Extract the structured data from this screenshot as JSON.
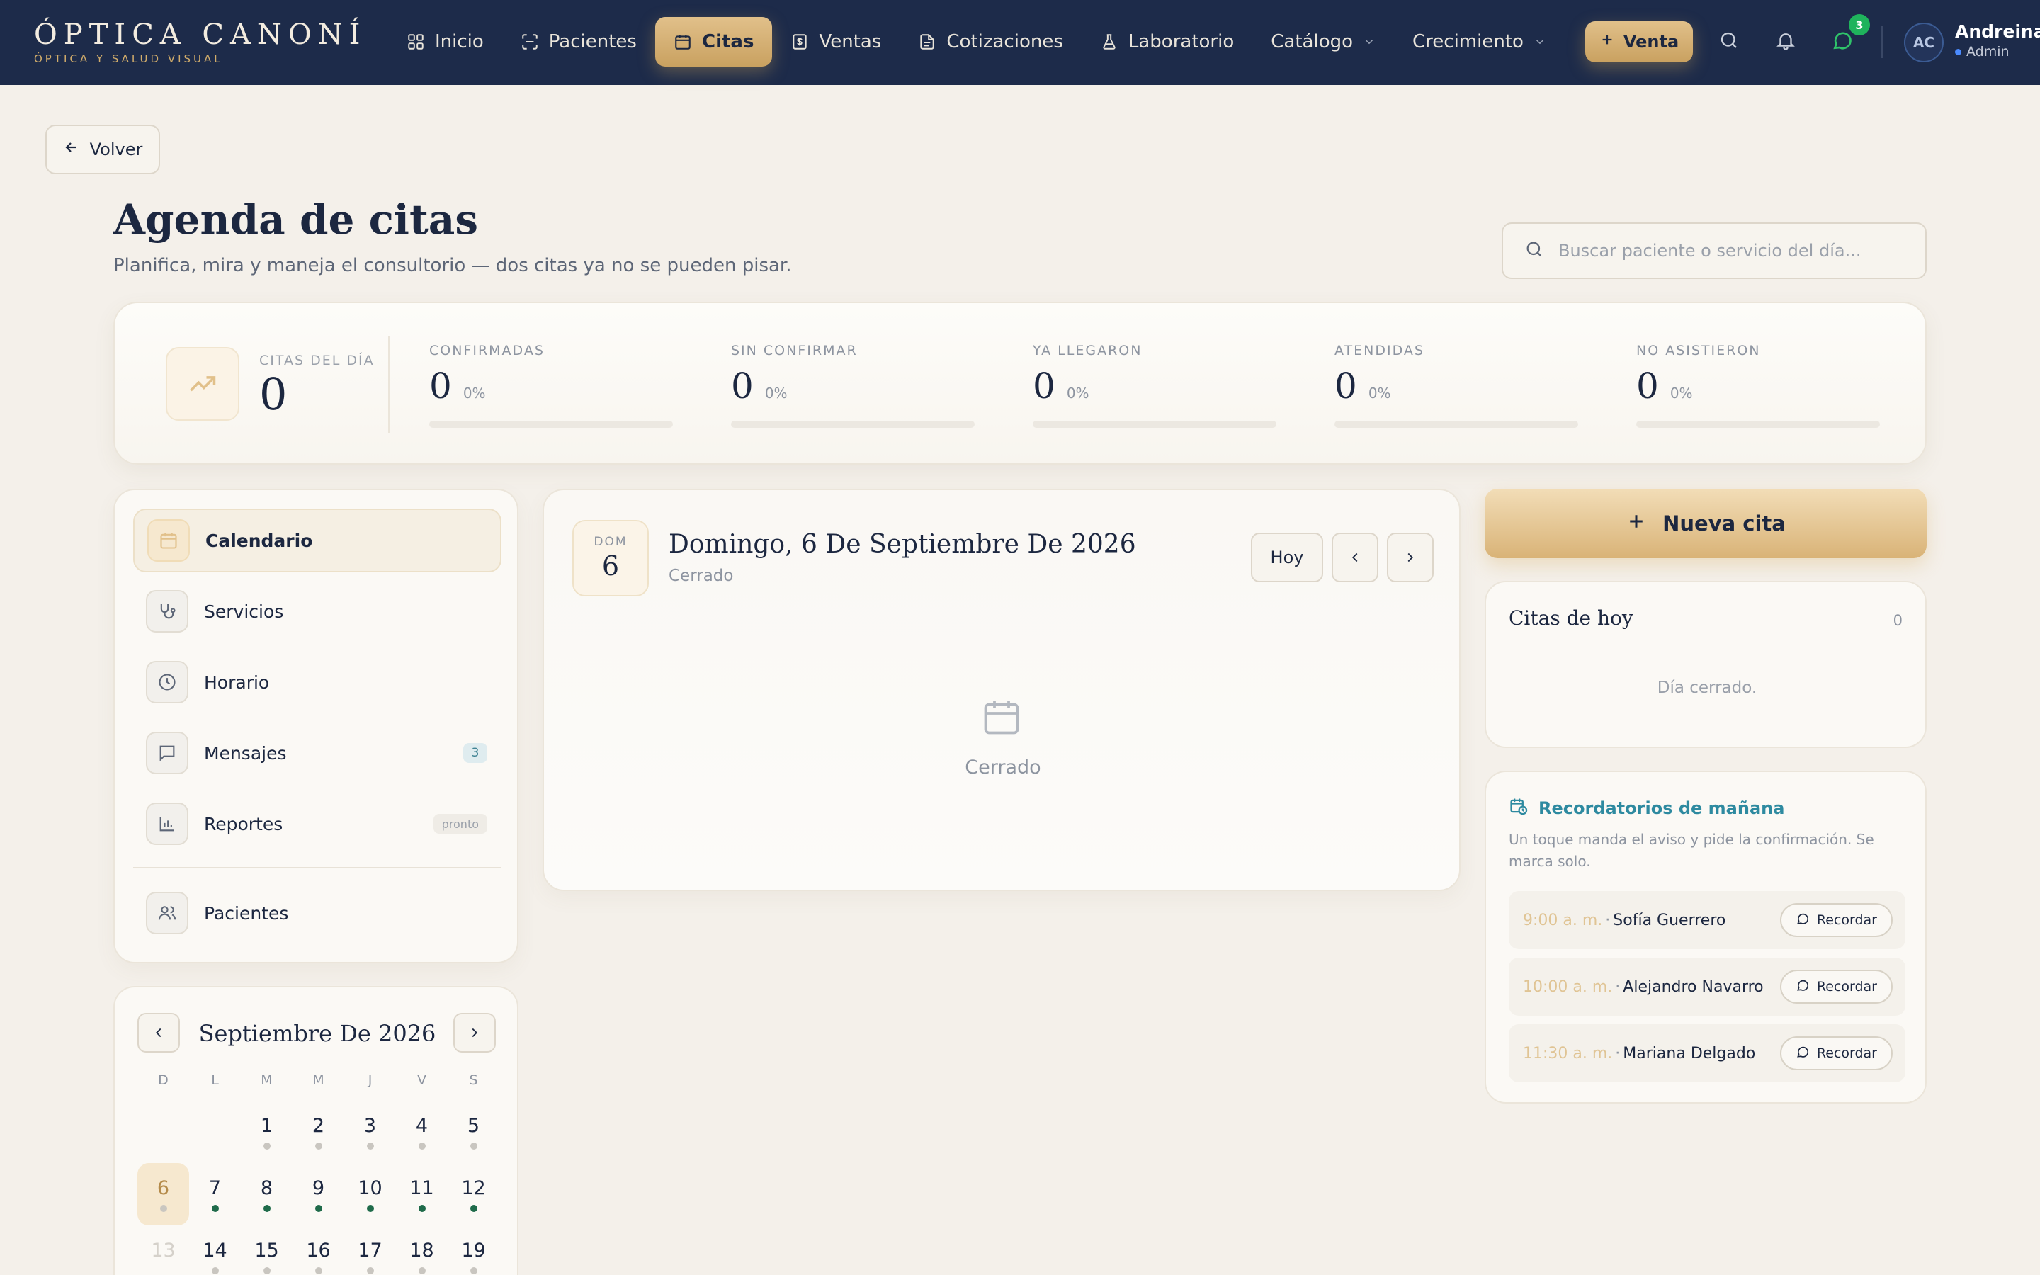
{
  "brand": {
    "name": "ÓPTICA CANONÍ",
    "tagline": "ÓPTICA Y SALUD VISUAL"
  },
  "nav": {
    "items": [
      {
        "label": "Inicio",
        "icon": "grid-icon"
      },
      {
        "label": "Pacientes",
        "icon": "scan-icon"
      },
      {
        "label": "Citas",
        "icon": "calendar-icon",
        "active": true
      },
      {
        "label": "Ventas",
        "icon": "receipt-icon"
      },
      {
        "label": "Cotizaciones",
        "icon": "document-icon"
      },
      {
        "label": "Laboratorio",
        "icon": "flask-icon"
      },
      {
        "label": "Catálogo",
        "icon": "chevron-down-icon"
      },
      {
        "label": "Crecimiento",
        "icon": "chevron-down-icon"
      }
    ],
    "venta_label": "Venta",
    "messages_badge": "3",
    "user": {
      "initials": "AC",
      "name": "Andreina",
      "role": "Admin"
    }
  },
  "page": {
    "back_label": "Volver",
    "title": "Agenda de citas",
    "subtitle": "Planifica, mira y maneja el consultorio — dos citas ya no se pueden pisar.",
    "search_placeholder": "Buscar paciente o servicio del día..."
  },
  "stats": {
    "main": {
      "label": "CITAS DEL DÍA",
      "value": "0"
    },
    "columns": [
      {
        "label": "CONFIRMADAS",
        "value": "0",
        "pct": "0%",
        "fill": 0
      },
      {
        "label": "SIN CONFIRMAR",
        "value": "0",
        "pct": "0%",
        "fill": 0
      },
      {
        "label": "YA LLEGARON",
        "value": "0",
        "pct": "0%",
        "fill": 0
      },
      {
        "label": "ATENDIDAS",
        "value": "0",
        "pct": "0%",
        "fill": 0
      },
      {
        "label": "NO ASISTIERON",
        "value": "0",
        "pct": "0%",
        "fill": 0
      }
    ]
  },
  "sidebar": {
    "items": [
      {
        "label": "Calendario",
        "icon": "calendar-icon",
        "active": true
      },
      {
        "label": "Servicios",
        "icon": "stethoscope-icon"
      },
      {
        "label": "Horario",
        "icon": "clock-icon"
      },
      {
        "label": "Mensajes",
        "icon": "message-icon",
        "badge": "3"
      },
      {
        "label": "Reportes",
        "icon": "bar-chart-icon",
        "soon": "pronto"
      },
      {
        "label": "Pacientes",
        "icon": "users-icon"
      }
    ]
  },
  "mini_calendar": {
    "title": "Septiembre De 2026",
    "weekdays": [
      "D",
      "L",
      "M",
      "M",
      "J",
      "V",
      "S"
    ],
    "weeks": [
      [
        "",
        "",
        "1",
        "2",
        "3",
        "4",
        "5"
      ],
      [
        "6",
        "7",
        "8",
        "9",
        "10",
        "11",
        "12"
      ],
      [
        "13",
        "14",
        "15",
        "16",
        "17",
        "18",
        "19"
      ]
    ],
    "selected": "6",
    "dot_colors": {
      "gray": "#c9c6c0",
      "green": "#1f6b4a"
    }
  },
  "day_view": {
    "dow": "DOM",
    "day_num": "6",
    "title": "Domingo, 6 De Septiembre De 2026",
    "status": "Cerrado",
    "today_label": "Hoy",
    "empty_label": "Cerrado"
  },
  "right": {
    "new_label": "Nueva cita",
    "today": {
      "title": "Citas de hoy",
      "count": "0",
      "empty": "Día cerrado."
    },
    "reminders": {
      "title": "Recordatorios de mañana",
      "description": "Un toque manda el aviso y pide la confirmación. Se marca solo.",
      "button_label": "Recordar",
      "items": [
        {
          "time": "9:00 a. m.",
          "name": "Sofía Guerrero"
        },
        {
          "time": "10:00 a. m.",
          "name": "Alejandro Navarro"
        },
        {
          "time": "11:30 a. m.",
          "name": "Mariana Delgado"
        }
      ]
    }
  },
  "colors": {
    "navy": "#1d2b4a",
    "gold": "#c9a160",
    "teal": "#2e8aa0",
    "green": "#1fb35c"
  }
}
